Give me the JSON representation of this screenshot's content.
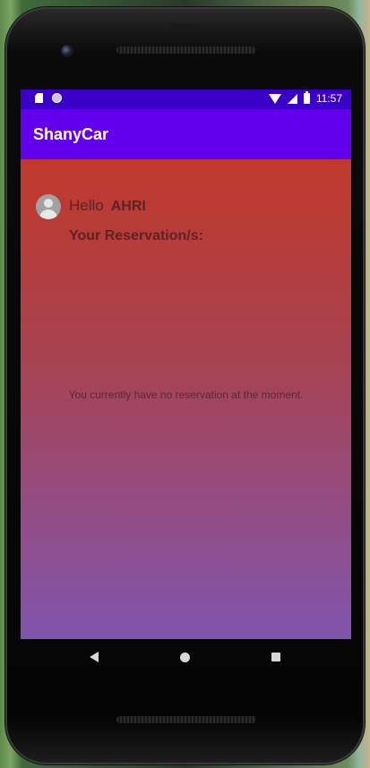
{
  "status_bar": {
    "time": "11:57",
    "left_icons": [
      "sd-card-icon",
      "circle-notification-icon"
    ],
    "right_icons": [
      "wifi-icon",
      "signal-icon",
      "battery-icon"
    ]
  },
  "app_bar": {
    "title": "ShanyCar",
    "color": "#6200ee"
  },
  "greeting": {
    "hello": "Hello",
    "user_name": "AHRI"
  },
  "reservations": {
    "heading": "Your Reservation/s:",
    "empty_message": "You currently have no reservation at the moment."
  },
  "nav_bar": {
    "buttons": [
      "back-icon",
      "home-icon",
      "recents-icon"
    ]
  },
  "colors": {
    "status_bar": "#3a00c9",
    "gradient_top": "#c0392b",
    "gradient_bottom": "#7f55ae"
  }
}
